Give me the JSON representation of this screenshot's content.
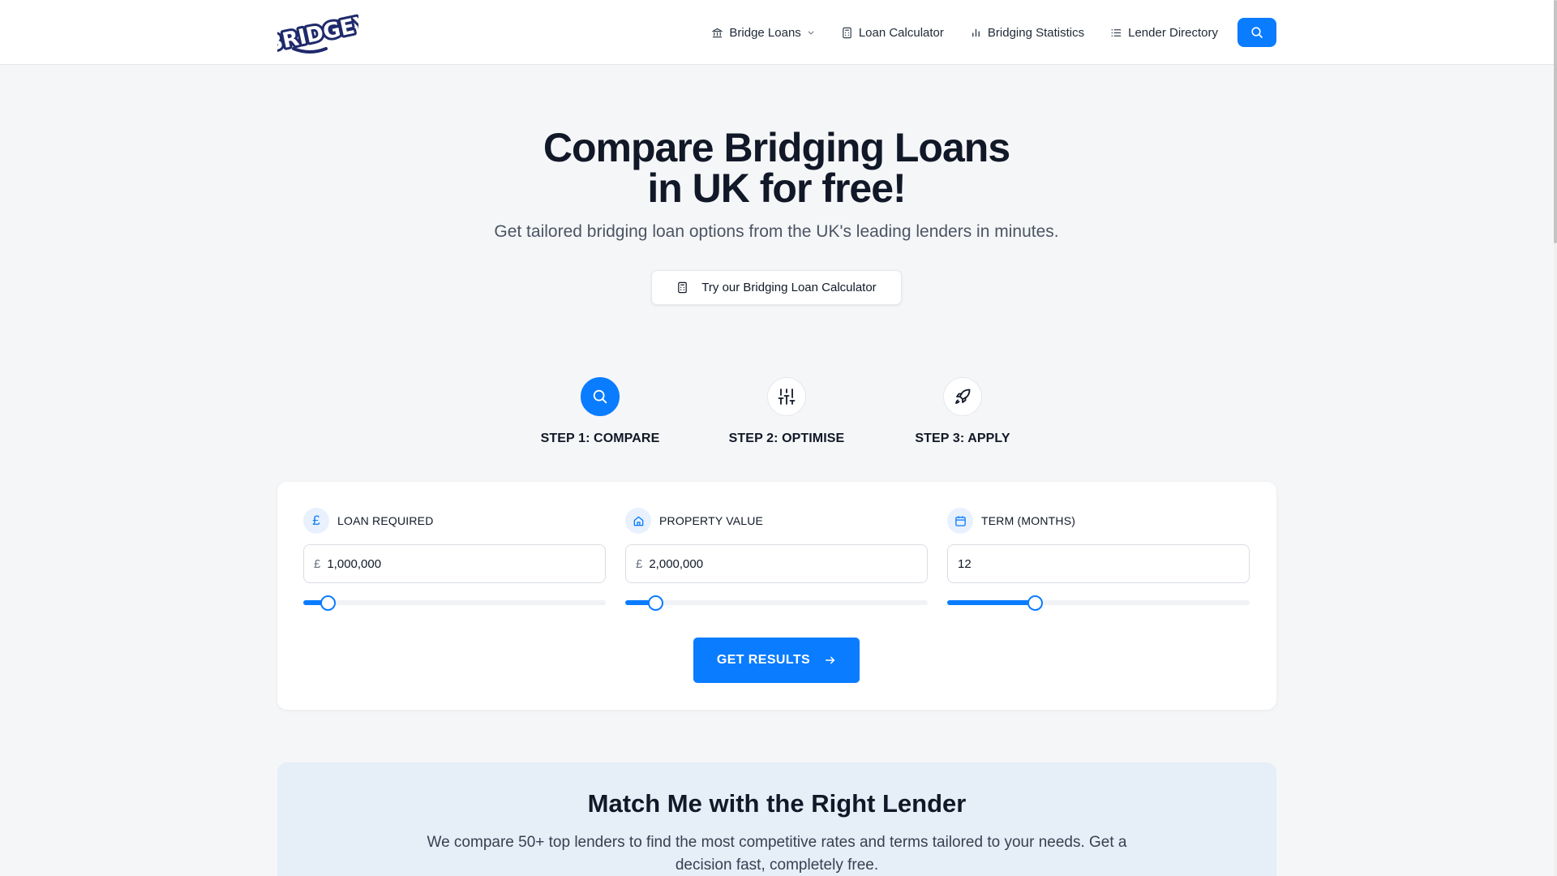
{
  "header": {
    "logo_text": "BRIDGEY",
    "nav": [
      {
        "label": "Bridge Loans",
        "icon": "bank-icon"
      },
      {
        "label": "Loan Calculator",
        "icon": "calculator-icon"
      },
      {
        "label": "Bridging Statistics",
        "icon": "bar-chart-icon"
      },
      {
        "label": "Lender Directory",
        "icon": "list-icon"
      }
    ],
    "search_icon": "search-icon"
  },
  "hero": {
    "title_line1": "Compare Bridging Loans",
    "title_line2": "in UK for free!",
    "subtitle": "Get tailored bridging loan options from the UK's leading lenders in minutes.",
    "calc_button": "Try our Bridging Loan Calculator"
  },
  "steps": [
    {
      "label": "STEP 1: COMPARE",
      "icon": "search-icon",
      "active": true
    },
    {
      "label": "STEP 2: OPTIMISE",
      "icon": "sliders-icon",
      "active": false
    },
    {
      "label": "STEP 3: APPLY",
      "icon": "rocket-icon",
      "active": false
    }
  ],
  "form": {
    "loan": {
      "label": "LOAN REQUIRED",
      "currency": "£",
      "icon_glyph": "£",
      "value": "1,000,000",
      "slider_fraction": 0.08
    },
    "property": {
      "label": "PROPERTY VALUE",
      "currency": "£",
      "value": "2,000,000",
      "slider_fraction": 0.1
    },
    "term": {
      "label": "TERM (MONTHS)",
      "value": "12",
      "slider_fraction": 0.29
    },
    "submit": "GET RESULTS"
  },
  "match": {
    "title": "Match Me with the Right Lender",
    "text": "We compare 50+ top lenders to find the most competitive rates and terms tailored to your needs. Get a decision fast, completely free."
  },
  "colors": {
    "accent": "#0a7cff",
    "logo": "#1f2a6b"
  }
}
